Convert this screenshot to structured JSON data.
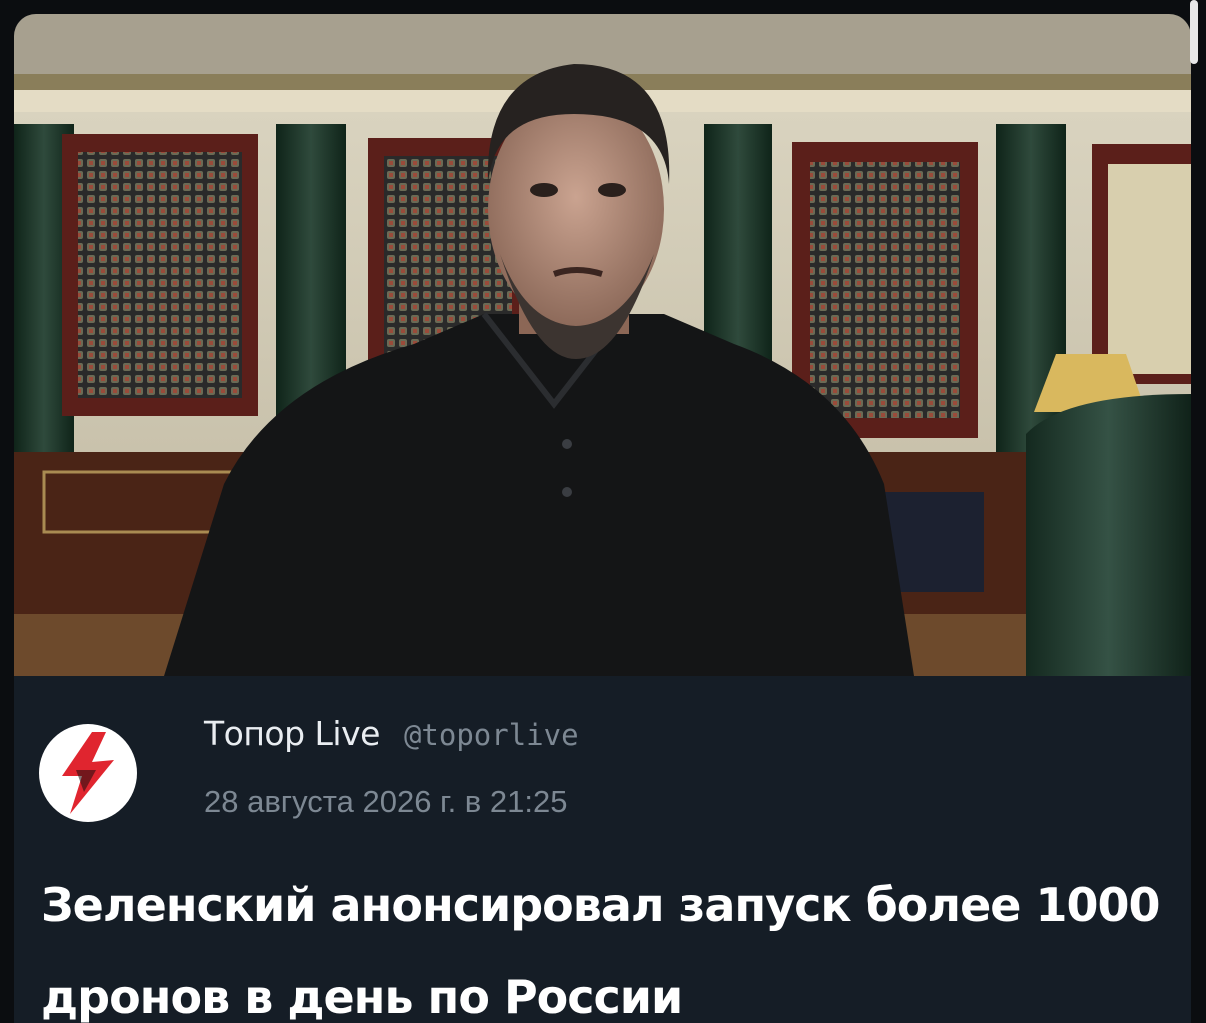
{
  "post": {
    "image_alt": "Видео-обращение в кабинете",
    "author_name": "Топор Live",
    "author_handle": "@toporlive",
    "date": "28 августа 2026 г. в 21:25",
    "headline": "Зеленский анонсировал запуск более 1000 дронов в день по России"
  },
  "colors": {
    "card_background": "#151d26",
    "page_background": "#0b0d10",
    "avatar_accent": "#e0252f",
    "headline_text": "#ffffff",
    "muted_text": "#7d8893"
  },
  "icons": {
    "avatar": "lightning-bolt-logo-icon"
  }
}
